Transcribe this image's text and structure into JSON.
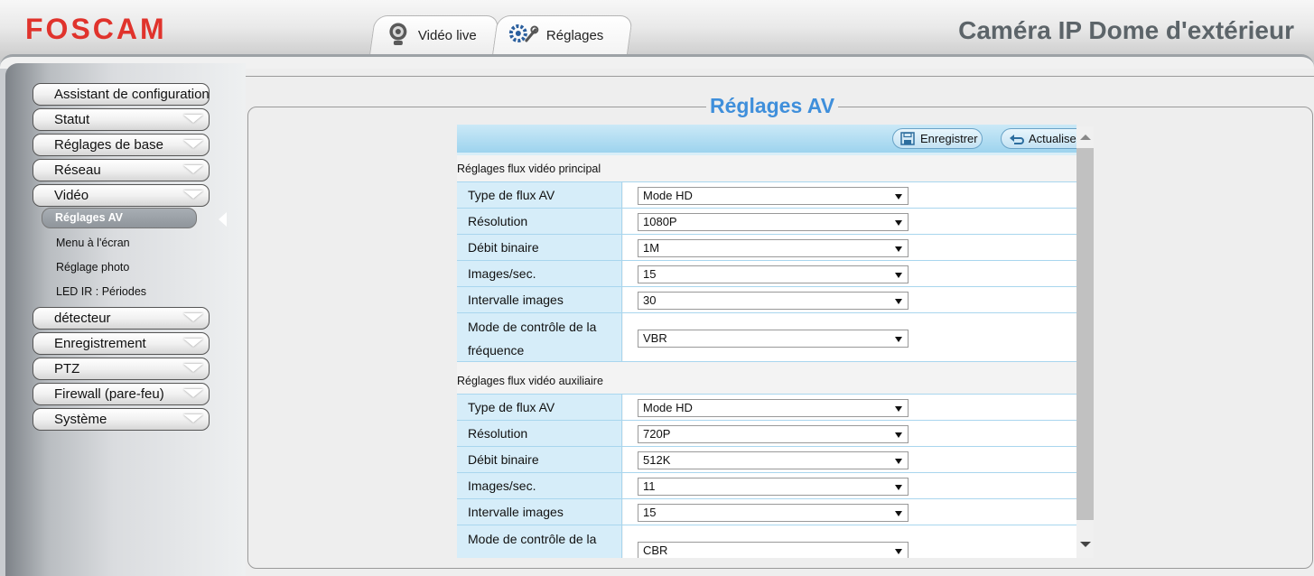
{
  "brand": {
    "logo": "FOSCAM",
    "product_title": "Caméra IP Dome d'extérieur"
  },
  "tabs": [
    {
      "label": "Vidéo live",
      "icon": "webcam-icon"
    },
    {
      "label": "Réglages",
      "icon": "gears-icon"
    }
  ],
  "sidebar": {
    "items": [
      {
        "label": "Assistant de configuration"
      },
      {
        "label": "Statut"
      },
      {
        "label": "Réglages de base"
      },
      {
        "label": "Réseau"
      },
      {
        "label": "Vidéo"
      },
      {
        "label": "détecteur"
      },
      {
        "label": "Enregistrement"
      },
      {
        "label": "PTZ"
      },
      {
        "label": "Firewall (pare-feu)"
      },
      {
        "label": "Système"
      }
    ],
    "video_subitems": [
      {
        "label": "Réglages AV",
        "active": true
      },
      {
        "label": "Menu à l'écran"
      },
      {
        "label": "Réglage photo"
      },
      {
        "label": "LED IR : Périodes"
      }
    ]
  },
  "page": {
    "title": "Réglages AV",
    "toolbar": {
      "save_label": "Enregistrer",
      "refresh_label": "Actualiser"
    },
    "main_stream": {
      "title": "Réglages flux vidéo principal",
      "rows": [
        {
          "label": "Type de flux AV",
          "value": "Mode HD"
        },
        {
          "label": "Résolution",
          "value": "1080P"
        },
        {
          "label": "Débit binaire",
          "value": "1M"
        },
        {
          "label": "Images/sec.",
          "value": "15"
        },
        {
          "label": "Intervalle images",
          "value": "30"
        },
        {
          "label": "Mode de contrôle de la fréquence",
          "value": "VBR"
        }
      ]
    },
    "sub_stream": {
      "title": "Réglages flux vidéo auxiliaire",
      "rows": [
        {
          "label": "Type de flux AV",
          "value": "Mode HD"
        },
        {
          "label": "Résolution",
          "value": "720P"
        },
        {
          "label": "Débit binaire",
          "value": "512K"
        },
        {
          "label": "Images/sec.",
          "value": "11"
        },
        {
          "label": "Intervalle images",
          "value": "15"
        },
        {
          "label": "Mode de contrôle de la fréquence",
          "value": "CBR"
        }
      ]
    }
  },
  "colors": {
    "brand_red": "#e0332c",
    "title_blue": "#3f8fdb",
    "label_bg": "#d6edf9",
    "toolbar_blue": "#9dd3ee"
  }
}
